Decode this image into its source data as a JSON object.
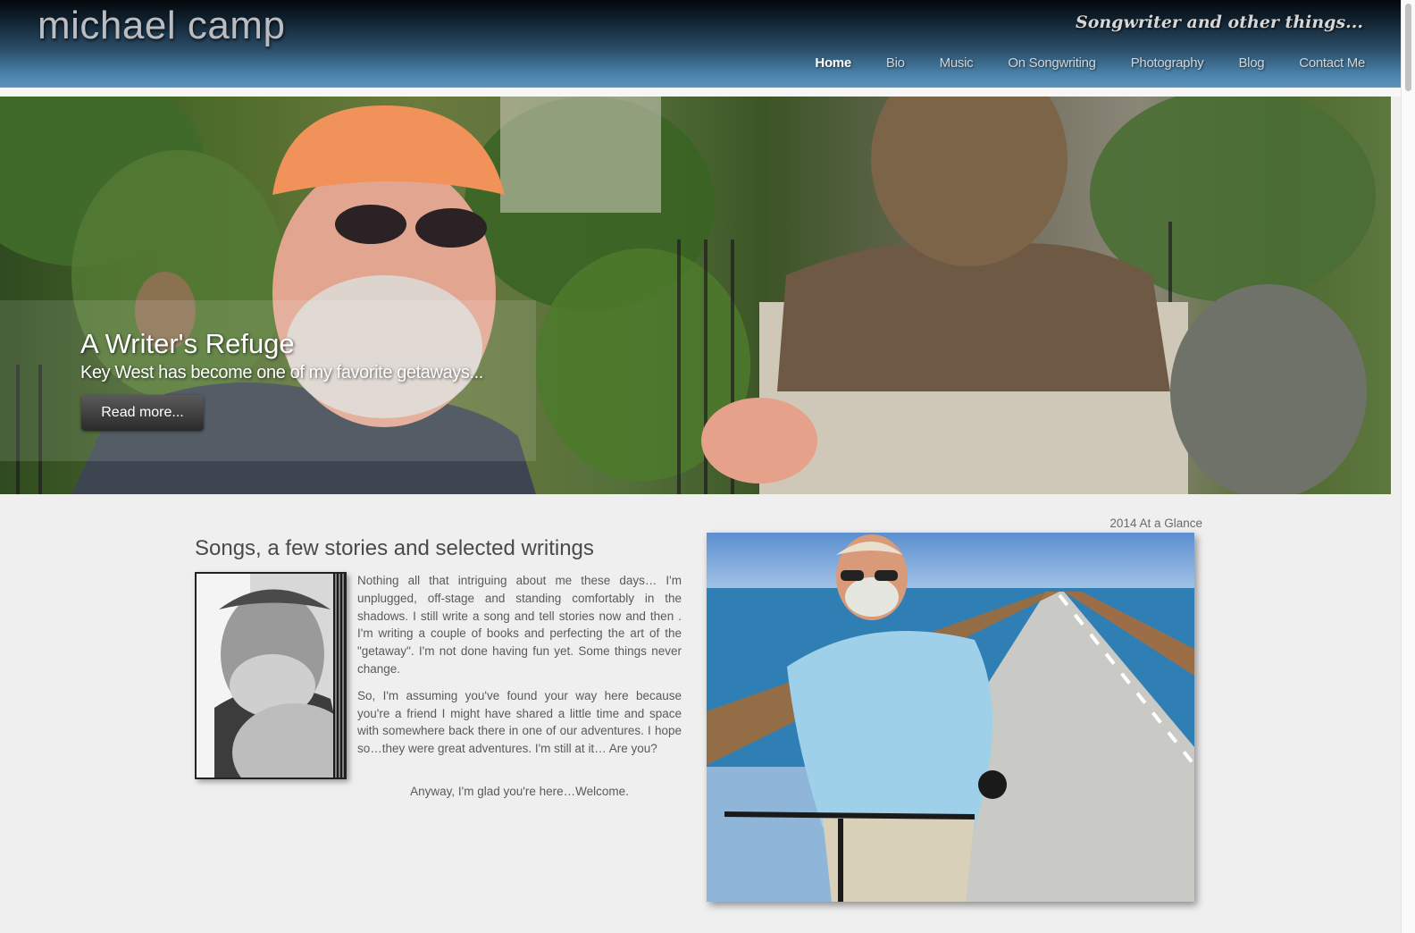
{
  "site": {
    "logo": "michael camp",
    "tagline": "Songwriter and other things..."
  },
  "nav": {
    "items": [
      {
        "label": "Home",
        "active": true
      },
      {
        "label": "Bio"
      },
      {
        "label": "Music"
      },
      {
        "label": "On Songwriting"
      },
      {
        "label": "Photography"
      },
      {
        "label": "Blog"
      },
      {
        "label": "Contact Me"
      }
    ]
  },
  "hero": {
    "title": "A Writer's Refuge",
    "subtitle": "Key West has become one of my favorite getaways...",
    "button_label": "Read more..."
  },
  "main": {
    "title": "Songs, a few stories and selected writings",
    "paragraph1": "Nothing all that intriguing about me these days… I'm unplugged, off-stage and standing comfortably in the shadows. I still write a song and tell stories now and then . I'm writing a couple of books and perfecting the art of the \"getaway\". I'm not done having fun yet. Some things never change.",
    "paragraph2": "So, I'm assuming you've found your way here because you're a friend I might have shared a little time and space with somewhere back there in one of our adventures. I hope so…they were great adventures. I'm still at it… Are you?",
    "welcome": "Anyway, I'm glad you're here…Welcome."
  },
  "aside": {
    "glance_label": "2014 At a Glance"
  },
  "colors": {
    "header_top": "#03070b",
    "header_bottom": "#5a94bd",
    "page_bg": "#efefef",
    "body_text": "#5a5a5a"
  }
}
